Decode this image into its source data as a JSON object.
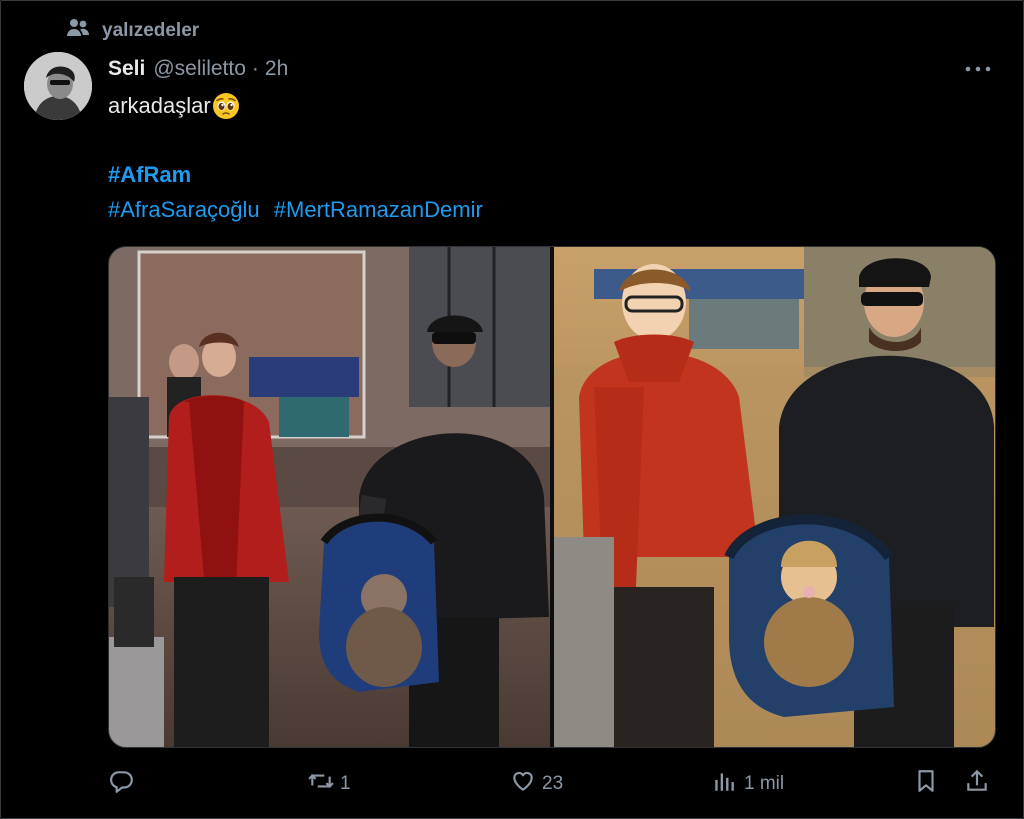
{
  "social_context": {
    "icon": "people-icon",
    "text": "yalızedeler"
  },
  "author": {
    "display_name": "Seli",
    "handle": "@seliletto",
    "separator": "·",
    "time": "2h"
  },
  "tweet": {
    "text_line": "arkadaşlar",
    "emoji": "pleading-face-emoji",
    "hashtags_line1": [
      "#AfRam"
    ],
    "hashtags_line2": [
      "#AfraSaraçoğlu",
      "#MertRamazanDemir"
    ]
  },
  "actions": {
    "reply_count": "",
    "retweet_count": "1",
    "like_count": "23",
    "views_count": "1 mil"
  },
  "colors": {
    "accent": "#1d9bf0",
    "muted": "#8b98a5",
    "text": "#e7e9ea",
    "background": "#000000"
  }
}
